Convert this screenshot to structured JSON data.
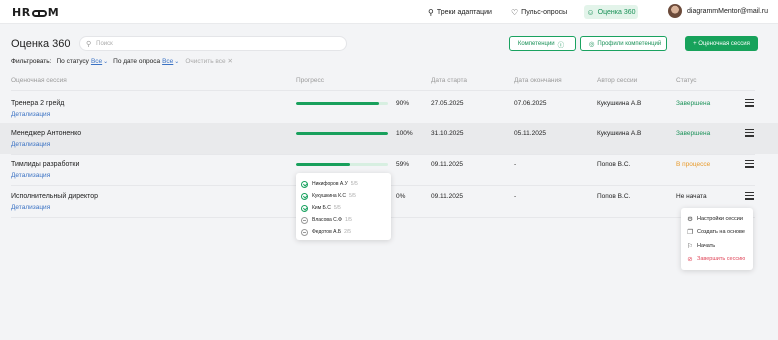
{
  "header": {
    "logo": "HROOM",
    "nav": [
      {
        "label": "Треки адаптации",
        "icon": "track-icon"
      },
      {
        "label": "Пульс-опросы",
        "icon": "heart-icon"
      },
      {
        "label": "Оценка 360",
        "icon": "people-icon"
      }
    ],
    "user_email": "diagrammMentor@mail.ru"
  },
  "page": {
    "title": "Оценка 360",
    "search_placeholder": "Поиск",
    "buttons": {
      "competencies": "Компетенции",
      "profiles": "Профили компетенций",
      "new_session": "+ Оценочная сессия"
    },
    "filters": {
      "label": "Фильтровать:",
      "by_status": "По статусу",
      "by_status_value": "Все",
      "by_date": "По дате опроса",
      "by_date_value": "Все",
      "clear": "Очистить все ✕"
    }
  },
  "table": {
    "columns": [
      "Оценочная сессия",
      "Прогресс",
      "Дата старта",
      "Дата окончания",
      "Автор сессии",
      "Статус"
    ],
    "detail_label": "Детализация",
    "rows": [
      {
        "name": "Тренера 2 грейд",
        "progress": 90,
        "progress_label": "90%",
        "start": "27.05.2025",
        "end": "07.06.2025",
        "author": "Кукушкина А.В",
        "status": "Завершена",
        "status_kind": "done"
      },
      {
        "name": "Менеджер Антоненко",
        "progress": 100,
        "progress_label": "100%",
        "start": "31.10.2025",
        "end": "05.11.2025",
        "author": "Кукушкина А.В",
        "status": "Завершена",
        "status_kind": "done"
      },
      {
        "name": "Тимлиды разработки",
        "progress": 59,
        "progress_label": "59%",
        "start": "09.11.2025",
        "end": "-",
        "author": "Попов В.С.",
        "status": "В процессе",
        "status_kind": "prog"
      },
      {
        "name": "Исполнительный директор",
        "progress": 0,
        "progress_label": "0%",
        "start": "09.11.2025",
        "end": "-",
        "author": "Попов В.С.",
        "status": "Не начата",
        "status_kind": "none"
      }
    ]
  },
  "participants_popup": [
    {
      "name": "Никифоров А.У",
      "count": "5/5",
      "done": true
    },
    {
      "name": "Кукушкина К.С",
      "count": "5/5",
      "done": true
    },
    {
      "name": "Ким Б.С",
      "count": "5/5",
      "done": true
    },
    {
      "name": "Власова С.Ф",
      "count": "1/5",
      "done": false
    },
    {
      "name": "Федотов А.Б",
      "count": "2/5",
      "done": false
    }
  ],
  "actions_menu": [
    {
      "label": "Настройки сессии",
      "icon": "settings-icon"
    },
    {
      "label": "Создать на основе",
      "icon": "copy-icon"
    },
    {
      "label": "Начать",
      "icon": "flag-icon"
    },
    {
      "label": "Завершить сессию",
      "icon": "cancel-icon"
    }
  ],
  "colors": {
    "accent": "#17a25b",
    "link": "#3a72c4",
    "in_progress": "#e89a2b",
    "danger": "#e0475a"
  }
}
